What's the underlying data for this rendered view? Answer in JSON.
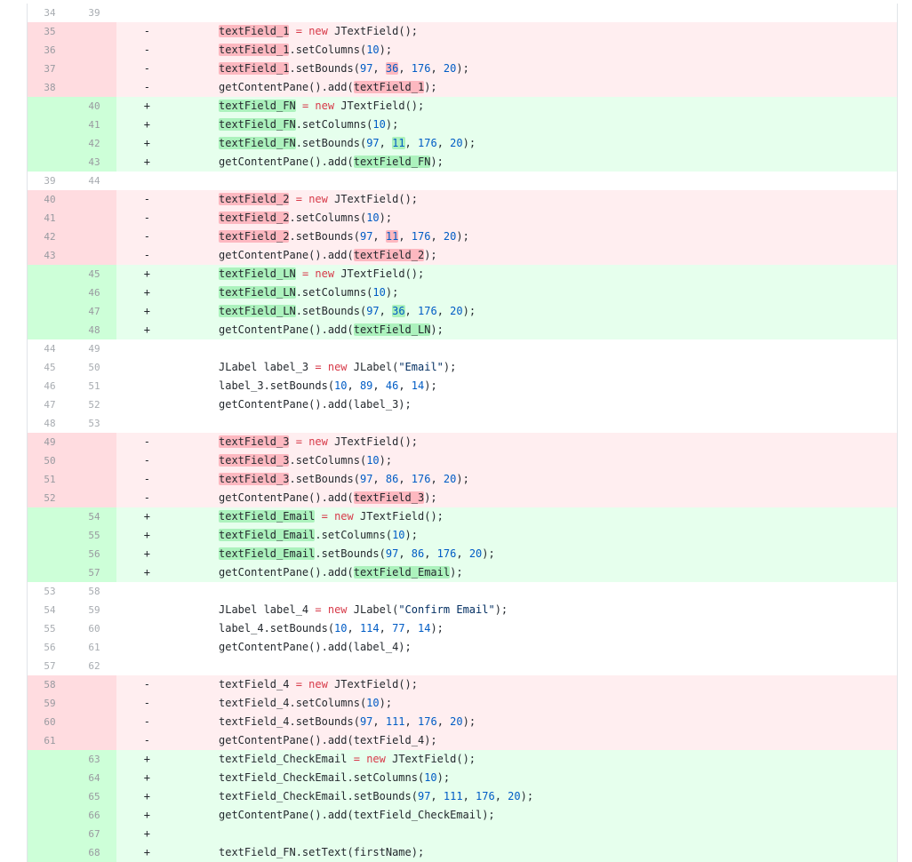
{
  "diff": {
    "lines": [
      {
        "type": "ctx",
        "old": "34",
        "new": "39",
        "sign": "",
        "tokens": []
      },
      {
        "type": "del",
        "old": "35",
        "new": "",
        "sign": "-",
        "tokens": [
          {
            "t": "textField_1",
            "c": "hl"
          },
          {
            "t": " "
          },
          {
            "t": "=",
            "c": "kw"
          },
          {
            "t": " "
          },
          {
            "t": "new",
            "c": "kw"
          },
          {
            "t": " JTextField();"
          }
        ]
      },
      {
        "type": "del",
        "old": "36",
        "new": "",
        "sign": "-",
        "tokens": [
          {
            "t": "textField_1",
            "c": "hl"
          },
          {
            "t": ".setColumns("
          },
          {
            "t": "10",
            "c": "num"
          },
          {
            "t": ");"
          }
        ]
      },
      {
        "type": "del",
        "old": "37",
        "new": "",
        "sign": "-",
        "tokens": [
          {
            "t": "textField_1",
            "c": "hl"
          },
          {
            "t": ".setBounds("
          },
          {
            "t": "97",
            "c": "num"
          },
          {
            "t": ", "
          },
          {
            "t": "36",
            "c": "hlnum"
          },
          {
            "t": ", "
          },
          {
            "t": "176",
            "c": "num"
          },
          {
            "t": ", "
          },
          {
            "t": "20",
            "c": "num"
          },
          {
            "t": ");"
          }
        ]
      },
      {
        "type": "del",
        "old": "38",
        "new": "",
        "sign": "-",
        "tokens": [
          {
            "t": "getContentPane().add("
          },
          {
            "t": "textField_1",
            "c": "hl"
          },
          {
            "t": ");"
          }
        ]
      },
      {
        "type": "add",
        "old": "",
        "new": "40",
        "sign": "+",
        "tokens": [
          {
            "t": "textField_FN",
            "c": "hl"
          },
          {
            "t": " "
          },
          {
            "t": "=",
            "c": "kw"
          },
          {
            "t": " "
          },
          {
            "t": "new",
            "c": "kw"
          },
          {
            "t": " JTextField();"
          }
        ]
      },
      {
        "type": "add",
        "old": "",
        "new": "41",
        "sign": "+",
        "tokens": [
          {
            "t": "textField_FN",
            "c": "hl"
          },
          {
            "t": ".setColumns("
          },
          {
            "t": "10",
            "c": "num"
          },
          {
            "t": ");"
          }
        ]
      },
      {
        "type": "add",
        "old": "",
        "new": "42",
        "sign": "+",
        "tokens": [
          {
            "t": "textField_FN",
            "c": "hl"
          },
          {
            "t": ".setBounds("
          },
          {
            "t": "97",
            "c": "num"
          },
          {
            "t": ", "
          },
          {
            "t": "11",
            "c": "hlnum"
          },
          {
            "t": ", "
          },
          {
            "t": "176",
            "c": "num"
          },
          {
            "t": ", "
          },
          {
            "t": "20",
            "c": "num"
          },
          {
            "t": ");"
          }
        ]
      },
      {
        "type": "add",
        "old": "",
        "new": "43",
        "sign": "+",
        "tokens": [
          {
            "t": "getContentPane().add("
          },
          {
            "t": "textField_FN",
            "c": "hl"
          },
          {
            "t": ");"
          }
        ]
      },
      {
        "type": "ctx",
        "old": "39",
        "new": "44",
        "sign": "",
        "tokens": []
      },
      {
        "type": "del",
        "old": "40",
        "new": "",
        "sign": "-",
        "tokens": [
          {
            "t": "textField_2",
            "c": "hl"
          },
          {
            "t": " "
          },
          {
            "t": "=",
            "c": "kw"
          },
          {
            "t": " "
          },
          {
            "t": "new",
            "c": "kw"
          },
          {
            "t": " JTextField();"
          }
        ]
      },
      {
        "type": "del",
        "old": "41",
        "new": "",
        "sign": "-",
        "tokens": [
          {
            "t": "textField_2",
            "c": "hl"
          },
          {
            "t": ".setColumns("
          },
          {
            "t": "10",
            "c": "num"
          },
          {
            "t": ");"
          }
        ]
      },
      {
        "type": "del",
        "old": "42",
        "new": "",
        "sign": "-",
        "tokens": [
          {
            "t": "textField_2",
            "c": "hl"
          },
          {
            "t": ".setBounds("
          },
          {
            "t": "97",
            "c": "num"
          },
          {
            "t": ", "
          },
          {
            "t": "11",
            "c": "hlnum"
          },
          {
            "t": ", "
          },
          {
            "t": "176",
            "c": "num"
          },
          {
            "t": ", "
          },
          {
            "t": "20",
            "c": "num"
          },
          {
            "t": ");"
          }
        ]
      },
      {
        "type": "del",
        "old": "43",
        "new": "",
        "sign": "-",
        "tokens": [
          {
            "t": "getContentPane().add("
          },
          {
            "t": "textField_2",
            "c": "hl"
          },
          {
            "t": ");"
          }
        ]
      },
      {
        "type": "add",
        "old": "",
        "new": "45",
        "sign": "+",
        "tokens": [
          {
            "t": "textField_LN",
            "c": "hl"
          },
          {
            "t": " "
          },
          {
            "t": "=",
            "c": "kw"
          },
          {
            "t": " "
          },
          {
            "t": "new",
            "c": "kw"
          },
          {
            "t": " JTextField();"
          }
        ]
      },
      {
        "type": "add",
        "old": "",
        "new": "46",
        "sign": "+",
        "tokens": [
          {
            "t": "textField_LN",
            "c": "hl"
          },
          {
            "t": ".setColumns("
          },
          {
            "t": "10",
            "c": "num"
          },
          {
            "t": ");"
          }
        ]
      },
      {
        "type": "add",
        "old": "",
        "new": "47",
        "sign": "+",
        "tokens": [
          {
            "t": "textField_LN",
            "c": "hl"
          },
          {
            "t": ".setBounds("
          },
          {
            "t": "97",
            "c": "num"
          },
          {
            "t": ", "
          },
          {
            "t": "36",
            "c": "hlnum"
          },
          {
            "t": ", "
          },
          {
            "t": "176",
            "c": "num"
          },
          {
            "t": ", "
          },
          {
            "t": "20",
            "c": "num"
          },
          {
            "t": ");"
          }
        ]
      },
      {
        "type": "add",
        "old": "",
        "new": "48",
        "sign": "+",
        "tokens": [
          {
            "t": "getContentPane().add("
          },
          {
            "t": "textField_LN",
            "c": "hl"
          },
          {
            "t": ");"
          }
        ]
      },
      {
        "type": "ctx",
        "old": "44",
        "new": "49",
        "sign": "",
        "tokens": []
      },
      {
        "type": "ctx",
        "old": "45",
        "new": "50",
        "sign": "",
        "tokens": [
          {
            "t": "JLabel label_3 "
          },
          {
            "t": "=",
            "c": "kw"
          },
          {
            "t": " "
          },
          {
            "t": "new",
            "c": "kw"
          },
          {
            "t": " JLabel("
          },
          {
            "t": "\"Email\"",
            "c": "str"
          },
          {
            "t": ");"
          }
        ]
      },
      {
        "type": "ctx",
        "old": "46",
        "new": "51",
        "sign": "",
        "tokens": [
          {
            "t": "label_3.setBounds("
          },
          {
            "t": "10",
            "c": "num"
          },
          {
            "t": ", "
          },
          {
            "t": "89",
            "c": "num"
          },
          {
            "t": ", "
          },
          {
            "t": "46",
            "c": "num"
          },
          {
            "t": ", "
          },
          {
            "t": "14",
            "c": "num"
          },
          {
            "t": ");"
          }
        ]
      },
      {
        "type": "ctx",
        "old": "47",
        "new": "52",
        "sign": "",
        "tokens": [
          {
            "t": "getContentPane().add(label_3);"
          }
        ]
      },
      {
        "type": "ctx",
        "old": "48",
        "new": "53",
        "sign": "",
        "tokens": []
      },
      {
        "type": "del",
        "old": "49",
        "new": "",
        "sign": "-",
        "tokens": [
          {
            "t": "textField_3",
            "c": "hl"
          },
          {
            "t": " "
          },
          {
            "t": "=",
            "c": "kw"
          },
          {
            "t": " "
          },
          {
            "t": "new",
            "c": "kw"
          },
          {
            "t": " JTextField();"
          }
        ]
      },
      {
        "type": "del",
        "old": "50",
        "new": "",
        "sign": "-",
        "tokens": [
          {
            "t": "textField_3",
            "c": "hl"
          },
          {
            "t": ".setColumns("
          },
          {
            "t": "10",
            "c": "num"
          },
          {
            "t": ");"
          }
        ]
      },
      {
        "type": "del",
        "old": "51",
        "new": "",
        "sign": "-",
        "tokens": [
          {
            "t": "textField_3",
            "c": "hl"
          },
          {
            "t": ".setBounds("
          },
          {
            "t": "97",
            "c": "num"
          },
          {
            "t": ", "
          },
          {
            "t": "86",
            "c": "num"
          },
          {
            "t": ", "
          },
          {
            "t": "176",
            "c": "num"
          },
          {
            "t": ", "
          },
          {
            "t": "20",
            "c": "num"
          },
          {
            "t": ");"
          }
        ]
      },
      {
        "type": "del",
        "old": "52",
        "new": "",
        "sign": "-",
        "tokens": [
          {
            "t": "getContentPane().add("
          },
          {
            "t": "textField_3",
            "c": "hl"
          },
          {
            "t": ");"
          }
        ]
      },
      {
        "type": "add",
        "old": "",
        "new": "54",
        "sign": "+",
        "tokens": [
          {
            "t": "textField_Email",
            "c": "hl"
          },
          {
            "t": " "
          },
          {
            "t": "=",
            "c": "kw"
          },
          {
            "t": " "
          },
          {
            "t": "new",
            "c": "kw"
          },
          {
            "t": " JTextField();"
          }
        ]
      },
      {
        "type": "add",
        "old": "",
        "new": "55",
        "sign": "+",
        "tokens": [
          {
            "t": "textField_Email",
            "c": "hl"
          },
          {
            "t": ".setColumns("
          },
          {
            "t": "10",
            "c": "num"
          },
          {
            "t": ");"
          }
        ]
      },
      {
        "type": "add",
        "old": "",
        "new": "56",
        "sign": "+",
        "tokens": [
          {
            "t": "textField_Email",
            "c": "hl"
          },
          {
            "t": ".setBounds("
          },
          {
            "t": "97",
            "c": "num"
          },
          {
            "t": ", "
          },
          {
            "t": "86",
            "c": "num"
          },
          {
            "t": ", "
          },
          {
            "t": "176",
            "c": "num"
          },
          {
            "t": ", "
          },
          {
            "t": "20",
            "c": "num"
          },
          {
            "t": ");"
          }
        ]
      },
      {
        "type": "add",
        "old": "",
        "new": "57",
        "sign": "+",
        "tokens": [
          {
            "t": "getContentPane().add("
          },
          {
            "t": "textField_Email",
            "c": "hl"
          },
          {
            "t": ");"
          }
        ]
      },
      {
        "type": "ctx",
        "old": "53",
        "new": "58",
        "sign": "",
        "tokens": []
      },
      {
        "type": "ctx",
        "old": "54",
        "new": "59",
        "sign": "",
        "tokens": [
          {
            "t": "JLabel label_4 "
          },
          {
            "t": "=",
            "c": "kw"
          },
          {
            "t": " "
          },
          {
            "t": "new",
            "c": "kw"
          },
          {
            "t": " JLabel("
          },
          {
            "t": "\"Confirm Email\"",
            "c": "str"
          },
          {
            "t": ");"
          }
        ]
      },
      {
        "type": "ctx",
        "old": "55",
        "new": "60",
        "sign": "",
        "tokens": [
          {
            "t": "label_4.setBounds("
          },
          {
            "t": "10",
            "c": "num"
          },
          {
            "t": ", "
          },
          {
            "t": "114",
            "c": "num"
          },
          {
            "t": ", "
          },
          {
            "t": "77",
            "c": "num"
          },
          {
            "t": ", "
          },
          {
            "t": "14",
            "c": "num"
          },
          {
            "t": ");"
          }
        ]
      },
      {
        "type": "ctx",
        "old": "56",
        "new": "61",
        "sign": "",
        "tokens": [
          {
            "t": "getContentPane().add(label_4);"
          }
        ]
      },
      {
        "type": "ctx",
        "old": "57",
        "new": "62",
        "sign": "",
        "tokens": []
      },
      {
        "type": "del",
        "old": "58",
        "new": "",
        "sign": "-",
        "tokens": [
          {
            "t": "textField_4 "
          },
          {
            "t": "=",
            "c": "kw"
          },
          {
            "t": " "
          },
          {
            "t": "new",
            "c": "kw"
          },
          {
            "t": " JTextField();"
          }
        ]
      },
      {
        "type": "del",
        "old": "59",
        "new": "",
        "sign": "-",
        "tokens": [
          {
            "t": "textField_4.setColumns("
          },
          {
            "t": "10",
            "c": "num"
          },
          {
            "t": ");"
          }
        ]
      },
      {
        "type": "del",
        "old": "60",
        "new": "",
        "sign": "-",
        "tokens": [
          {
            "t": "textField_4.setBounds("
          },
          {
            "t": "97",
            "c": "num"
          },
          {
            "t": ", "
          },
          {
            "t": "111",
            "c": "num"
          },
          {
            "t": ", "
          },
          {
            "t": "176",
            "c": "num"
          },
          {
            "t": ", "
          },
          {
            "t": "20",
            "c": "num"
          },
          {
            "t": ");"
          }
        ]
      },
      {
        "type": "del",
        "old": "61",
        "new": "",
        "sign": "-",
        "tokens": [
          {
            "t": "getContentPane().add(textField_4);"
          }
        ]
      },
      {
        "type": "add",
        "old": "",
        "new": "63",
        "sign": "+",
        "tokens": [
          {
            "t": "textField_CheckEmail "
          },
          {
            "t": "=",
            "c": "kw"
          },
          {
            "t": " "
          },
          {
            "t": "new",
            "c": "kw"
          },
          {
            "t": " JTextField();"
          }
        ]
      },
      {
        "type": "add",
        "old": "",
        "new": "64",
        "sign": "+",
        "tokens": [
          {
            "t": "textField_CheckEmail.setColumns("
          },
          {
            "t": "10",
            "c": "num"
          },
          {
            "t": ");"
          }
        ]
      },
      {
        "type": "add",
        "old": "",
        "new": "65",
        "sign": "+",
        "tokens": [
          {
            "t": "textField_CheckEmail.setBounds("
          },
          {
            "t": "97",
            "c": "num"
          },
          {
            "t": ", "
          },
          {
            "t": "111",
            "c": "num"
          },
          {
            "t": ", "
          },
          {
            "t": "176",
            "c": "num"
          },
          {
            "t": ", "
          },
          {
            "t": "20",
            "c": "num"
          },
          {
            "t": ");"
          }
        ]
      },
      {
        "type": "add",
        "old": "",
        "new": "66",
        "sign": "+",
        "tokens": [
          {
            "t": "getContentPane().add(textField_CheckEmail);"
          }
        ]
      },
      {
        "type": "add",
        "old": "",
        "new": "67",
        "sign": "+",
        "tokens": []
      },
      {
        "type": "add",
        "old": "",
        "new": "68",
        "sign": "+",
        "tokens": [
          {
            "t": "textField_FN.setText(firstName);"
          }
        ]
      }
    ]
  }
}
